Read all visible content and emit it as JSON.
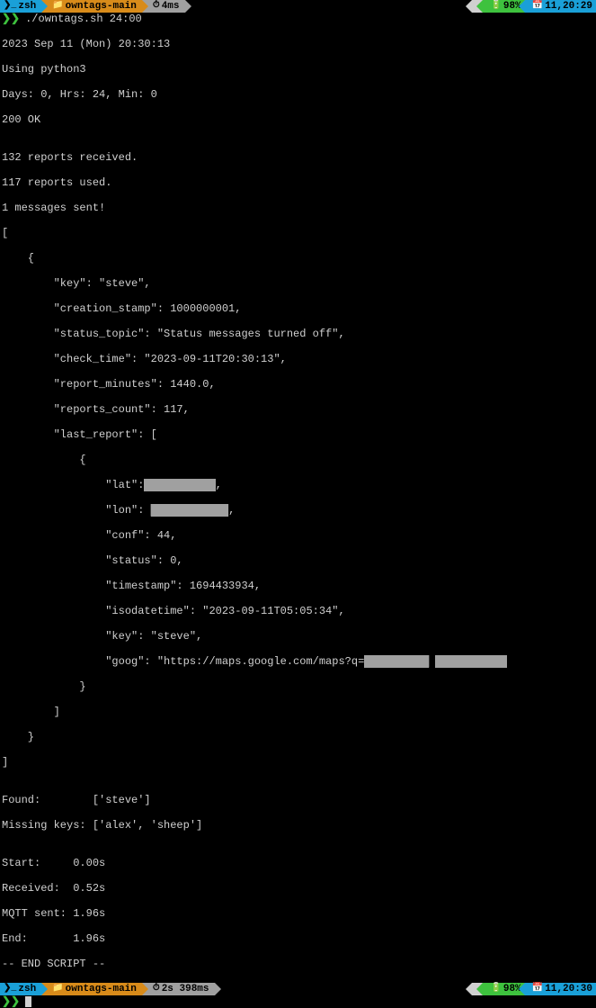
{
  "status_top": {
    "shell_icon": "❯_",
    "shell": "zsh",
    "folder_icon": "📁",
    "folder": "owntags-main",
    "timer_icon": "⏱",
    "timer": "4ms",
    "apple_icon": "",
    "bat_icon": "🔋",
    "bat": "98%",
    "clock_icon": "📅",
    "clock": "11,20:29"
  },
  "prompt1": {
    "glyph": "❯❯",
    "cmd": "./owntags.sh 24:00"
  },
  "out": {
    "l1": "2023 Sep 11 (Mon) 20:30:13",
    "l2": "Using python3",
    "l3": "Days: 0, Hrs: 24, Min: 0",
    "l4": "200 OK",
    "l5": "",
    "l6": "132 reports received.",
    "l7": "117 reports used.",
    "l8": "1 messages sent!",
    "l9": "[",
    "l10": "    {",
    "l11": "        \"key\": \"steve\",",
    "l12": "        \"creation_stamp\": 1000000001,",
    "l13": "        \"status_topic\": \"Status messages turned off\",",
    "l14": "        \"check_time\": \"2023-09-11T20:30:13\",",
    "l15": "        \"report_minutes\": 1440.0,",
    "l16": "        \"reports_count\": 117,",
    "l17": "        \"last_report\": [",
    "l18": "            {",
    "l19a": "                \"lat\":",
    "l19b": "███████████",
    "l19c": ",",
    "l20a": "                \"lon\": ",
    "l20b": "████████████",
    "l20c": ",",
    "l21": "                \"conf\": 44,",
    "l22": "                \"status\": 0,",
    "l23": "                \"timestamp\": 1694433934,",
    "l24": "                \"isodatetime\": \"2023-09-11T05:05:34\",",
    "l25": "                \"key\": \"steve\",",
    "l26a": "                \"goog\": \"https://maps.google.com/maps?q=",
    "l26b": "██████████",
    "l26c": " ",
    "l26d": "███████████",
    "l27": "            }",
    "l28": "        ]",
    "l29": "    }",
    "l30": "]",
    "l31": "",
    "l32": "Found:        ['steve']",
    "l33": "Missing keys: ['alex', 'sheep']",
    "l34": "",
    "l35": "Start:     0.00s",
    "l36": "Received:  0.52s",
    "l37": "MQTT sent: 1.96s",
    "l38": "End:       1.96s",
    "l39": "-- END SCRIPT --"
  },
  "status_bot": {
    "shell_icon": "❯_",
    "shell": "zsh",
    "folder_icon": "📁",
    "folder": "owntags-main",
    "timer_icon": "⏱",
    "timer": "2s 398ms",
    "apple_icon": "",
    "bat_icon": "🔋",
    "bat": "98%",
    "clock_icon": "📅",
    "clock": "11,20:30"
  },
  "prompt2": {
    "glyph": "❯❯"
  }
}
